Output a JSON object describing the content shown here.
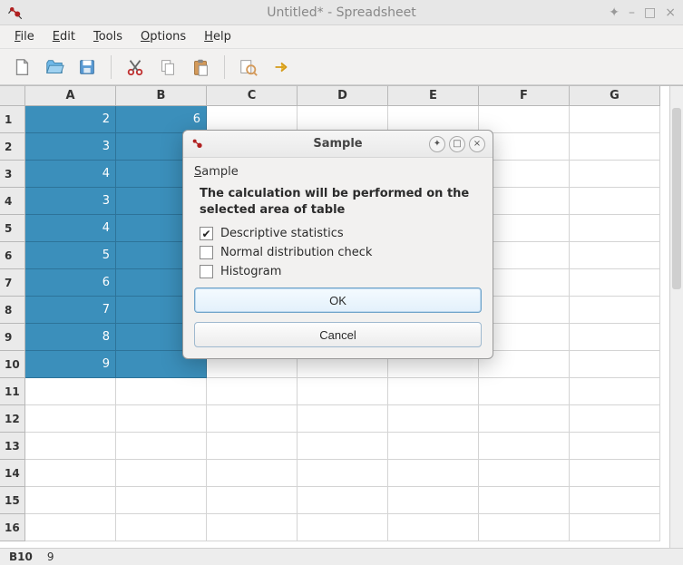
{
  "window": {
    "title": "Untitled* - Spreadsheet"
  },
  "menu": {
    "file": "File",
    "edit": "Edit",
    "tools": "Tools",
    "options": "Options",
    "help": "Help"
  },
  "columns": [
    "A",
    "B",
    "C",
    "D",
    "E",
    "F",
    "G"
  ],
  "rows": [
    "1",
    "2",
    "3",
    "4",
    "5",
    "6",
    "7",
    "8",
    "9",
    "10",
    "11",
    "12",
    "13",
    "14",
    "15",
    "16"
  ],
  "data": {
    "A": [
      "2",
      "3",
      "4",
      "3",
      "4",
      "5",
      "6",
      "7",
      "8",
      "9"
    ],
    "B": [
      "6",
      "",
      "",
      "",
      "",
      "",
      "",
      "",
      "",
      ""
    ]
  },
  "selection": {
    "cols": [
      "A",
      "B"
    ],
    "rowStart": 1,
    "rowEnd": 10
  },
  "status": {
    "cellref": "B10",
    "value": "9"
  },
  "dialog": {
    "title": "Sample",
    "section": "Sample",
    "description": "The calculation will be performed on the selected area of table",
    "opts": {
      "descriptive": {
        "label": "Descriptive statistics",
        "checked": true
      },
      "normal": {
        "label": "Normal distribution check",
        "checked": false
      },
      "histogram": {
        "label": "Histogram",
        "checked": false
      }
    },
    "ok": "OK",
    "cancel": "Cancel"
  }
}
